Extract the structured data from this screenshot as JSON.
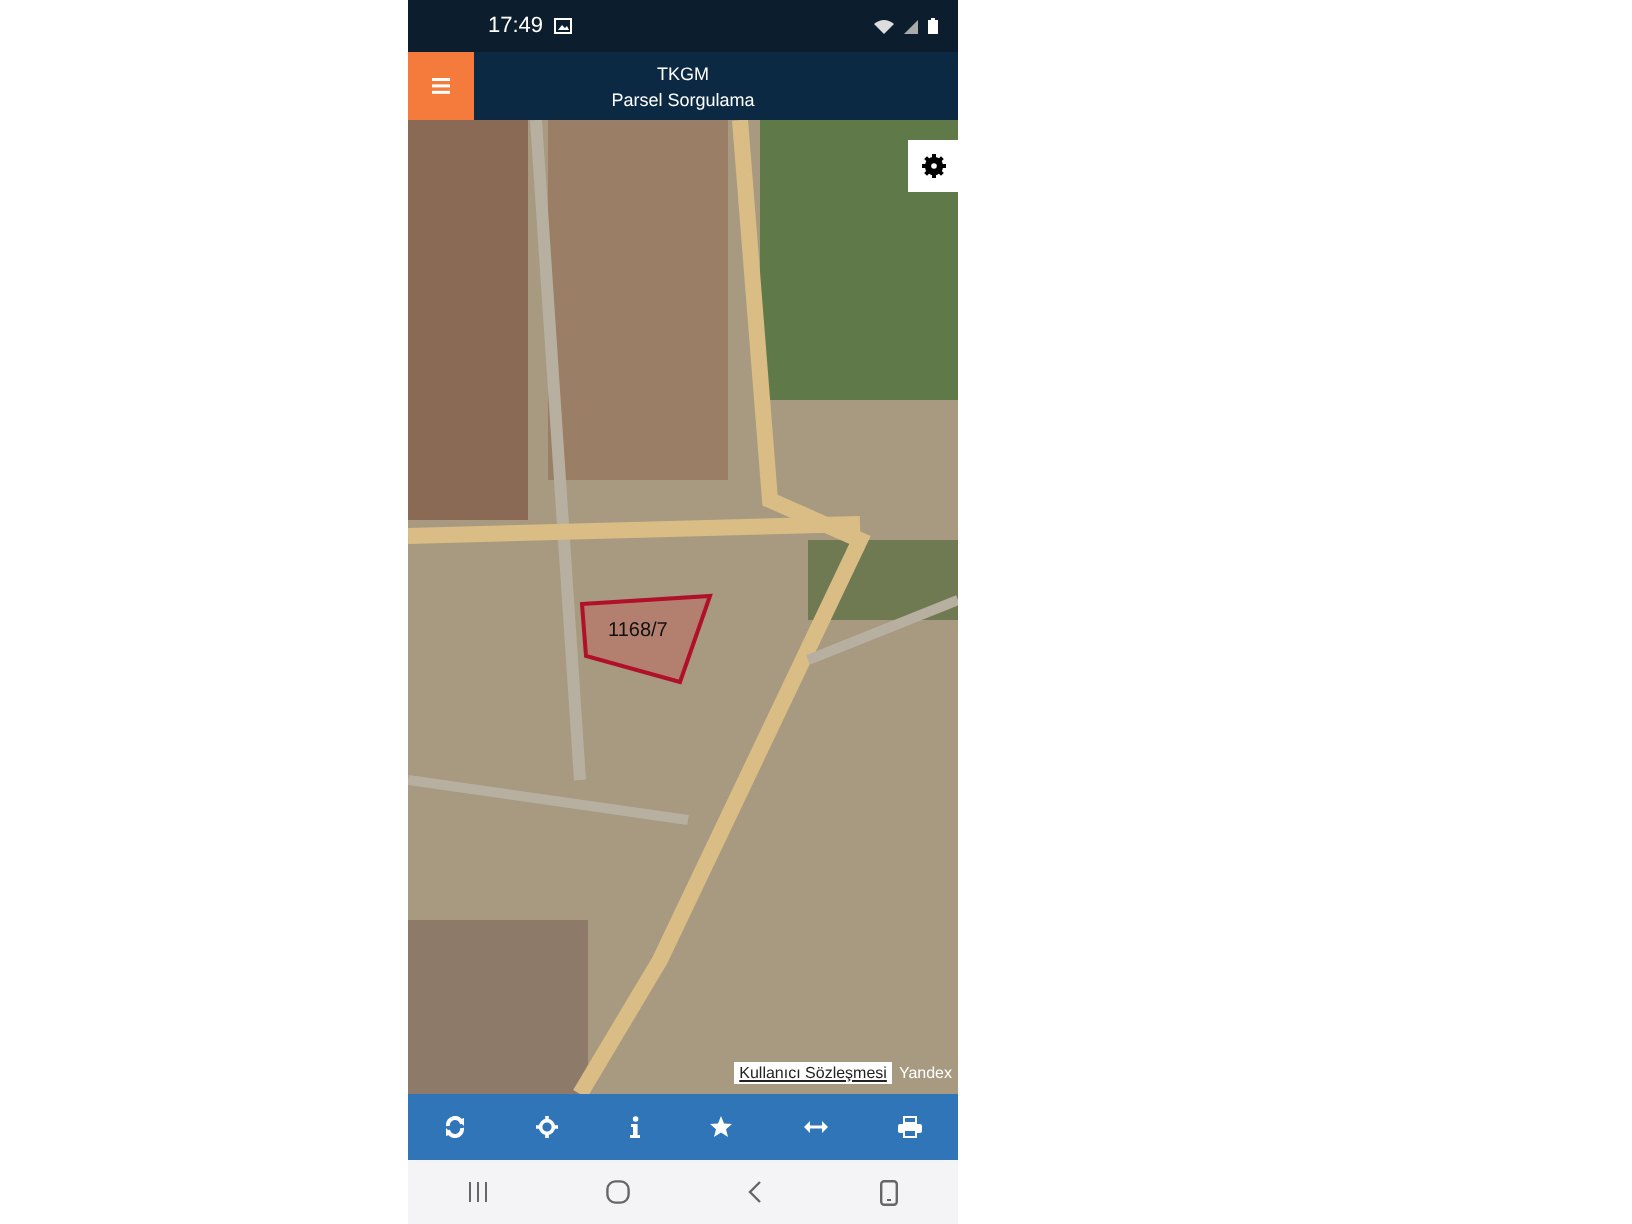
{
  "status_bar": {
    "time": "17:49"
  },
  "header": {
    "title": "TKGM",
    "subtitle": "Parsel Sorgulama"
  },
  "map": {
    "parcel_label": "1168/7",
    "attribution_link": "Kullanıcı Sözleşmesi",
    "attribution_provider": "Yandex"
  }
}
